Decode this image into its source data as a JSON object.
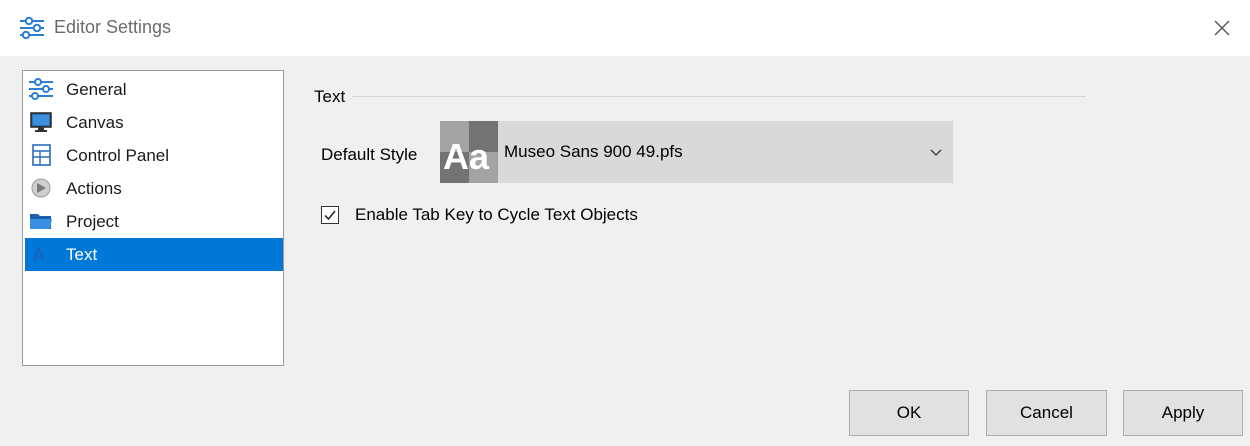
{
  "window": {
    "title": "Editor Settings",
    "title_icon": "sliders-icon",
    "close_icon": "close-icon"
  },
  "sidebar": {
    "items": [
      {
        "label": "General",
        "icon": "sliders-icon",
        "selected": false
      },
      {
        "label": "Canvas",
        "icon": "monitor-icon",
        "selected": false
      },
      {
        "label": "Control Panel",
        "icon": "control-panel-icon",
        "selected": false
      },
      {
        "label": "Actions",
        "icon": "actions-icon",
        "selected": false
      },
      {
        "label": "Project",
        "icon": "folder-icon",
        "selected": false
      },
      {
        "label": "Text",
        "icon": "text-icon",
        "selected": true
      }
    ]
  },
  "main": {
    "section_title": "Text",
    "default_style": {
      "label": "Default Style",
      "thumb_text": "Aa",
      "value": "Museo Sans 900 49.pfs"
    },
    "tab_cycle": {
      "label": "Enable Tab Key to Cycle Text Objects",
      "checked": true
    }
  },
  "buttons": {
    "ok": "OK",
    "cancel": "Cancel",
    "apply": "Apply"
  },
  "colors": {
    "selection": "#0078d7",
    "window_bg": "#f0f0f0",
    "title_bg": "#ffffff",
    "combo_bg": "#d9d9d9"
  }
}
